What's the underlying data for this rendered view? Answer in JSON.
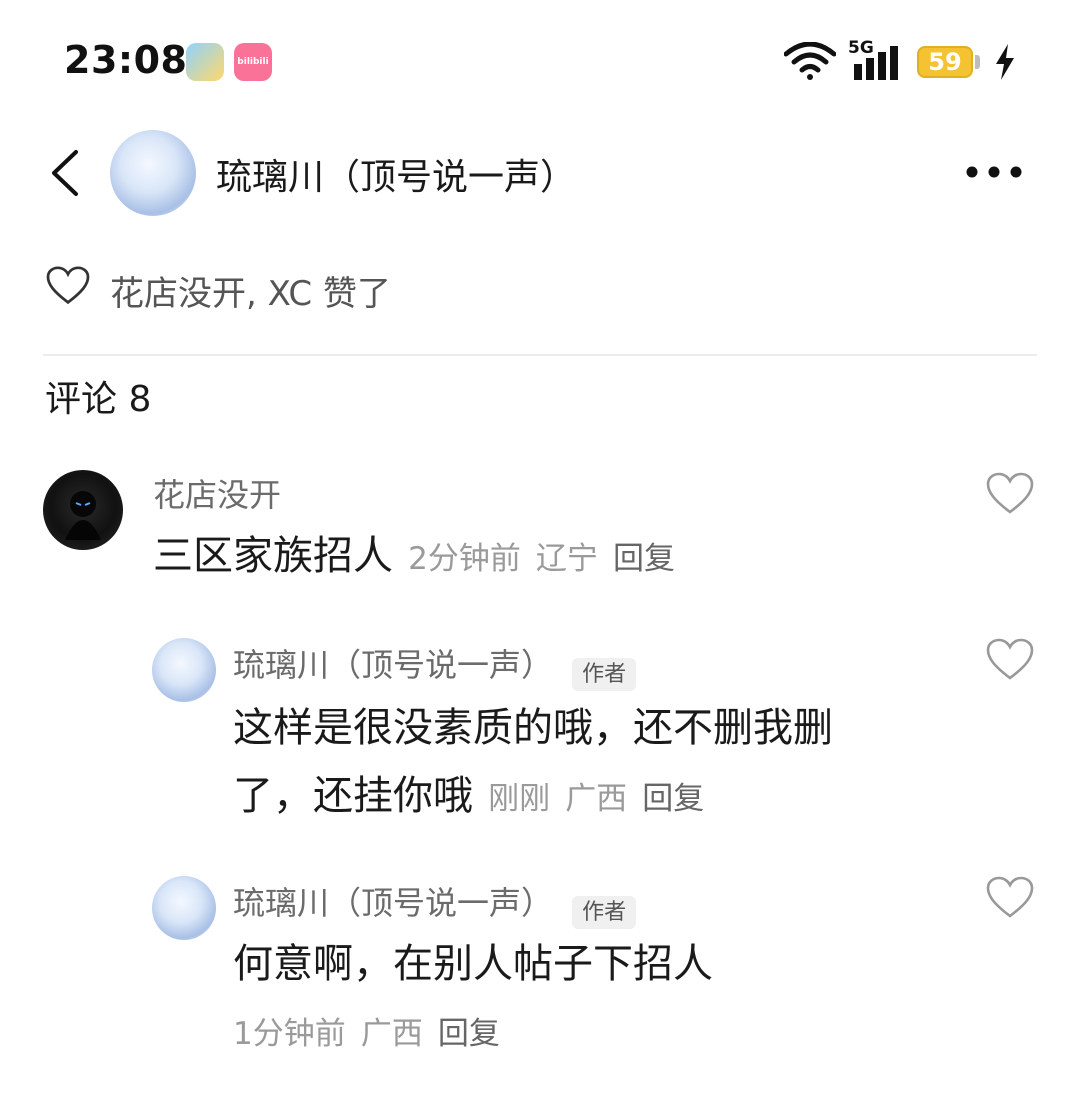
{
  "status_bar": {
    "time": "23:08",
    "network": "5G",
    "battery": "59",
    "icons": [
      "qq-app-icon",
      "bilibili-app-icon",
      "wifi-icon",
      "signal-icon",
      "battery-icon",
      "charging-icon"
    ],
    "bili_label": "bilibili"
  },
  "header": {
    "title": "琉璃川（顶号说一声）",
    "icons": [
      "back-chevron-icon",
      "more-dots-icon"
    ]
  },
  "likes": {
    "text": "花店没开, XC 赞了",
    "icon": "heart-outline-icon"
  },
  "comments": {
    "title": "评论 8",
    "items": [
      {
        "author": "花店没开",
        "text": "三区家族招人",
        "time": "2分钟前",
        "location": "辽宁",
        "reply": "回复"
      },
      {
        "author": "琉璃川（顶号说一声）",
        "badge": "作者",
        "text_line1": "这样是很没素质的哦，还不删我删",
        "text_line2": "了，还挂你哦",
        "time": "刚刚",
        "location": "广西",
        "reply": "回复"
      },
      {
        "author": "琉璃川（顶号说一声）",
        "badge": "作者",
        "text": "何意啊，在别人帖子下招人",
        "time": "1分钟前",
        "location": "广西",
        "reply": "回复"
      }
    ]
  },
  "colors": {
    "battery": "#f5c331",
    "bilibili": "#fb7299",
    "muted_text": "#9a9a9a"
  }
}
